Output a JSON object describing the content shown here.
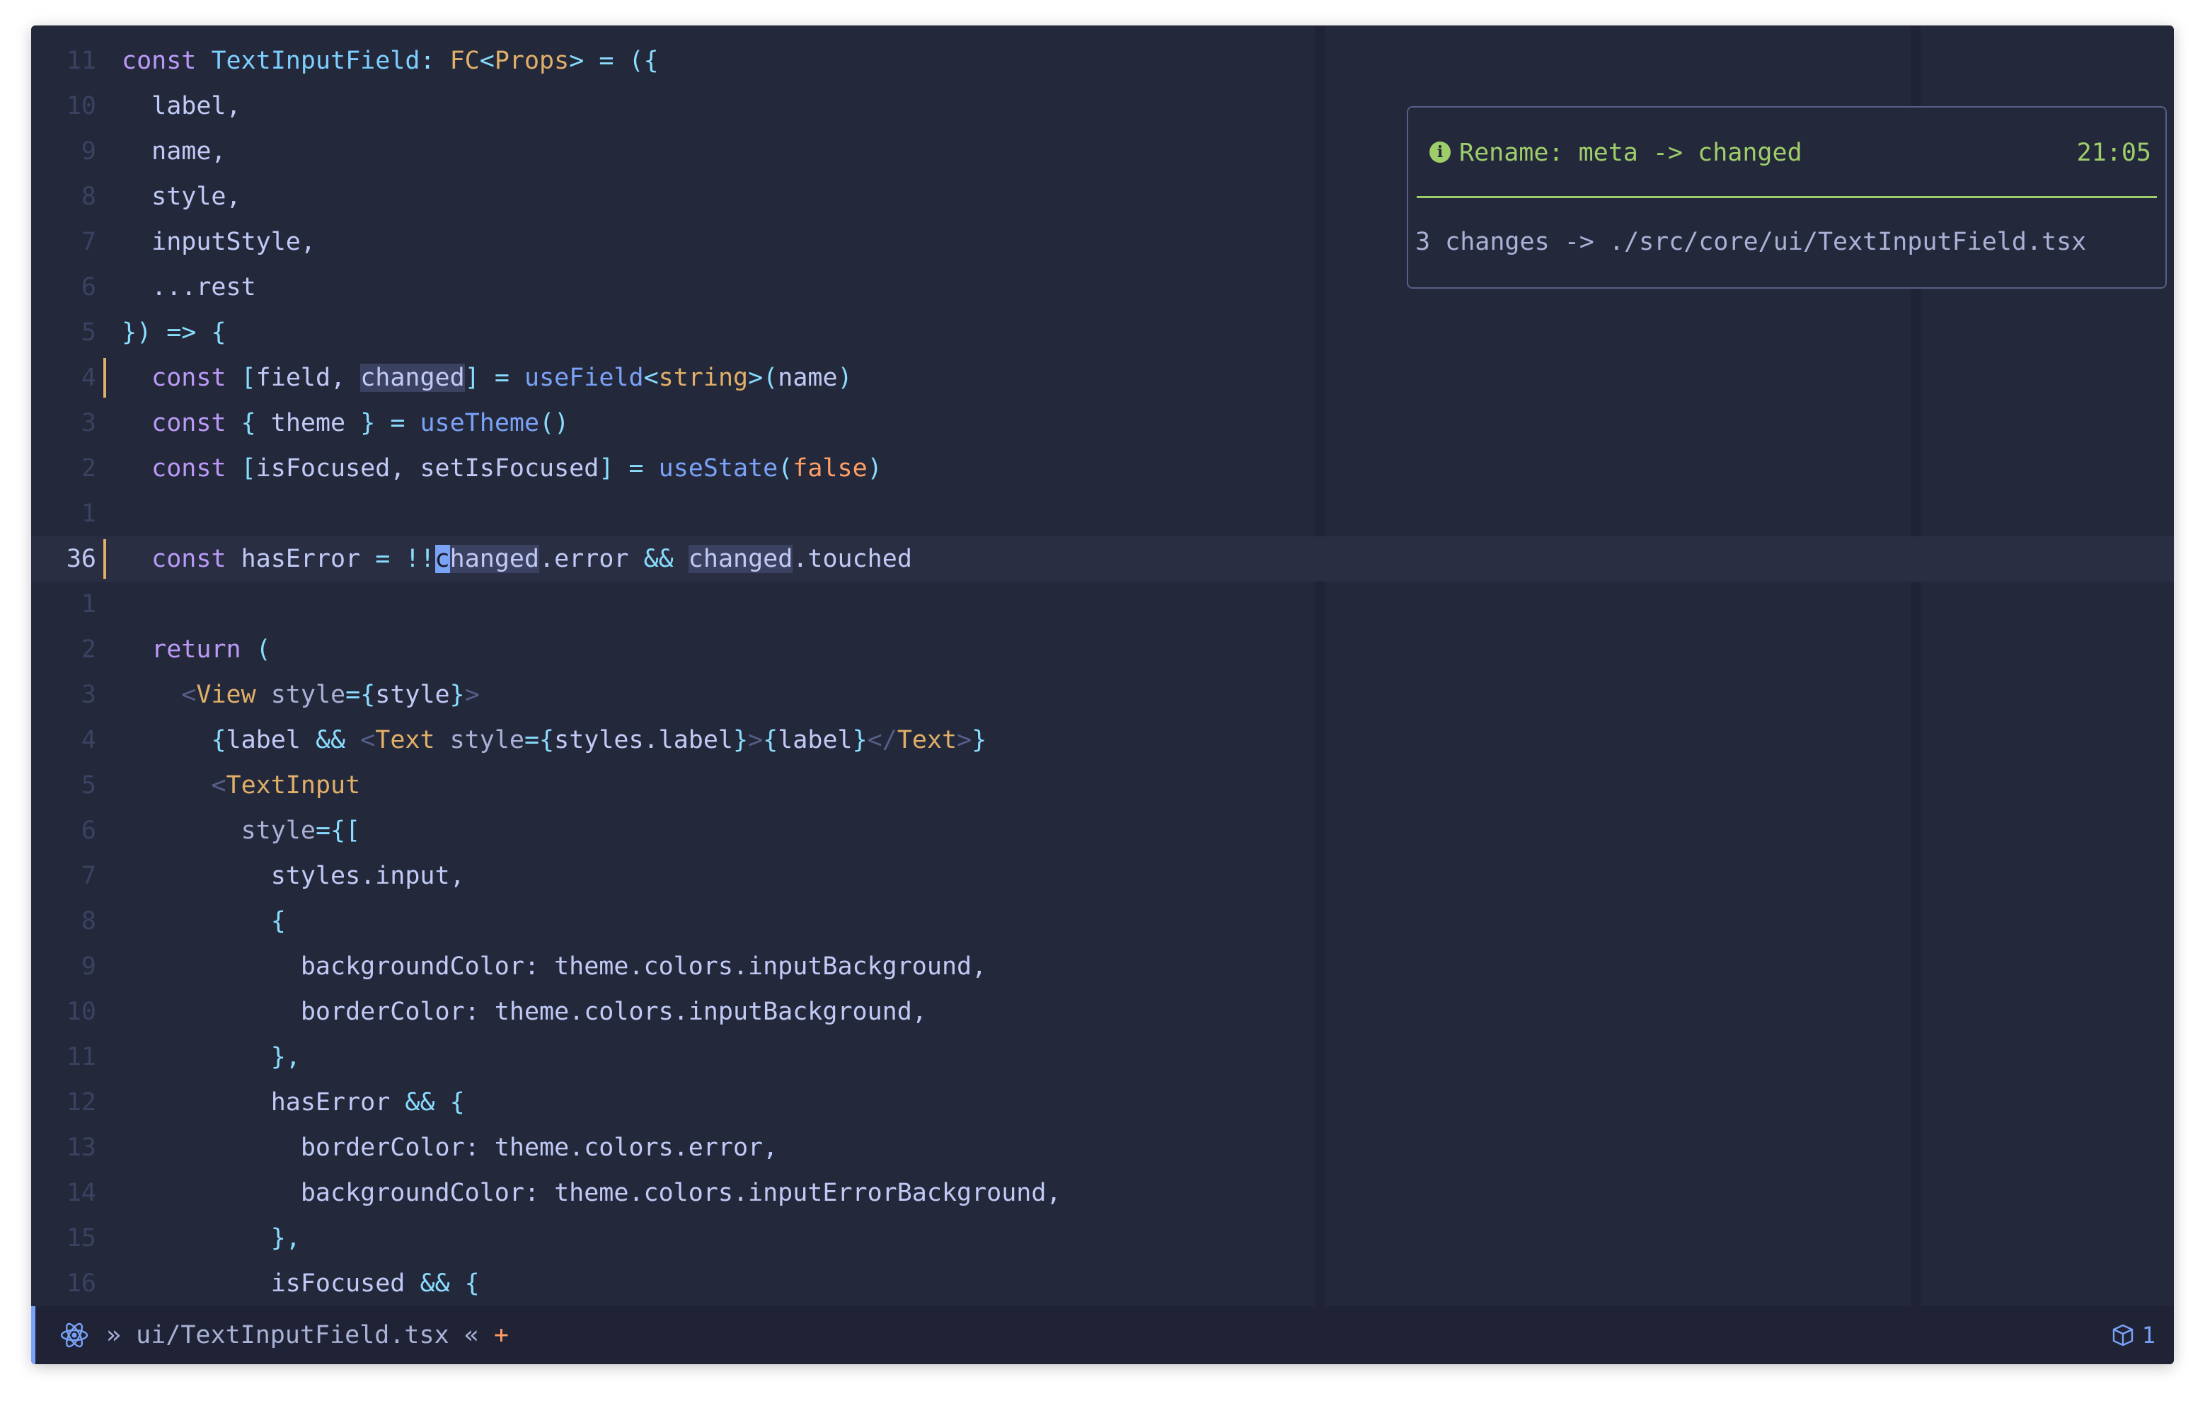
{
  "editor": {
    "lines": [
      {
        "num": "11",
        "current": false,
        "git": false,
        "tokens": [
          [
            "k",
            "const "
          ],
          [
            "t",
            "TextInputField"
          ],
          [
            "p",
            ": "
          ],
          [
            "y",
            "FC"
          ],
          [
            "p",
            "<"
          ],
          [
            "y",
            "Props"
          ],
          [
            "p",
            "> = ({"
          ]
        ]
      },
      {
        "num": "10",
        "current": false,
        "git": false,
        "tokens": [
          [
            "v",
            "  label,"
          ]
        ]
      },
      {
        "num": "9",
        "current": false,
        "git": false,
        "tokens": [
          [
            "v",
            "  name,"
          ]
        ]
      },
      {
        "num": "8",
        "current": false,
        "git": false,
        "tokens": [
          [
            "v",
            "  style,"
          ]
        ]
      },
      {
        "num": "7",
        "current": false,
        "git": false,
        "tokens": [
          [
            "v",
            "  inputStyle,"
          ]
        ]
      },
      {
        "num": "6",
        "current": false,
        "git": false,
        "tokens": [
          [
            "v",
            "  ...rest"
          ]
        ]
      },
      {
        "num": "5",
        "current": false,
        "git": false,
        "tokens": [
          [
            "p",
            "}) => {"
          ]
        ]
      },
      {
        "num": "4",
        "current": false,
        "git": true,
        "tokens": [
          [
            "v",
            "  "
          ],
          [
            "k",
            "const "
          ],
          [
            "p",
            "["
          ],
          [
            "v",
            "field, "
          ],
          [
            "hl",
            "changed"
          ],
          [
            "p",
            "] = "
          ],
          [
            "f",
            "useField"
          ],
          [
            "p",
            "<"
          ],
          [
            "y",
            "string"
          ],
          [
            "p",
            ">("
          ],
          [
            "v",
            "name"
          ],
          [
            "p",
            ")"
          ]
        ]
      },
      {
        "num": "3",
        "current": false,
        "git": false,
        "tokens": [
          [
            "v",
            "  "
          ],
          [
            "k",
            "const "
          ],
          [
            "p",
            "{ "
          ],
          [
            "v",
            "theme "
          ],
          [
            "p",
            "} = "
          ],
          [
            "f",
            "useTheme"
          ],
          [
            "p",
            "()"
          ]
        ]
      },
      {
        "num": "2",
        "current": false,
        "git": false,
        "tokens": [
          [
            "v",
            "  "
          ],
          [
            "k",
            "const "
          ],
          [
            "p",
            "["
          ],
          [
            "v",
            "isFocused, setIsFocused"
          ],
          [
            "p",
            "] = "
          ],
          [
            "f",
            "useState"
          ],
          [
            "p",
            "("
          ],
          [
            "o",
            "false"
          ],
          [
            "p",
            ")"
          ]
        ]
      },
      {
        "num": "1",
        "current": false,
        "git": false,
        "tokens": []
      },
      {
        "num": "36",
        "current": true,
        "git": true,
        "tokens": [
          [
            "v",
            "  "
          ],
          [
            "k",
            "const "
          ],
          [
            "v",
            "hasError "
          ],
          [
            "p",
            "= !!"
          ],
          [
            "cursor",
            "c"
          ],
          [
            "hl",
            "hanged"
          ],
          [
            "v",
            ".error "
          ],
          [
            "p",
            "&& "
          ],
          [
            "hl",
            "changed"
          ],
          [
            "v",
            ".touched"
          ]
        ]
      },
      {
        "num": "1",
        "current": false,
        "git": false,
        "tokens": []
      },
      {
        "num": "2",
        "current": false,
        "git": false,
        "tokens": [
          [
            "v",
            "  "
          ],
          [
            "k",
            "return "
          ],
          [
            "p",
            "("
          ]
        ]
      },
      {
        "num": "3",
        "current": false,
        "git": false,
        "tokens": [
          [
            "v",
            "    "
          ],
          [
            "tg",
            "<"
          ],
          [
            "y",
            "View "
          ],
          [
            "g",
            "style"
          ],
          [
            "p",
            "={"
          ],
          [
            "v",
            "style"
          ],
          [
            "p",
            "}"
          ],
          [
            "tg",
            ">"
          ]
        ]
      },
      {
        "num": "4",
        "current": false,
        "git": false,
        "tokens": [
          [
            "v",
            "      "
          ],
          [
            "p",
            "{"
          ],
          [
            "v",
            "label "
          ],
          [
            "p",
            "&& "
          ],
          [
            "tg",
            "<"
          ],
          [
            "y",
            "Text "
          ],
          [
            "g",
            "style"
          ],
          [
            "p",
            "={"
          ],
          [
            "v",
            "styles.label"
          ],
          [
            "p",
            "}"
          ],
          [
            "tg",
            ">"
          ],
          [
            "p",
            "{"
          ],
          [
            "v",
            "label"
          ],
          [
            "p",
            "}"
          ],
          [
            "tg",
            "</"
          ],
          [
            "y",
            "Text"
          ],
          [
            "tg",
            ">"
          ],
          [
            "p",
            "}"
          ]
        ]
      },
      {
        "num": "5",
        "current": false,
        "git": false,
        "tokens": [
          [
            "v",
            "      "
          ],
          [
            "tg",
            "<"
          ],
          [
            "y",
            "TextInput"
          ]
        ]
      },
      {
        "num": "6",
        "current": false,
        "git": false,
        "tokens": [
          [
            "v",
            "        "
          ],
          [
            "g",
            "style"
          ],
          [
            "p",
            "={["
          ]
        ]
      },
      {
        "num": "7",
        "current": false,
        "git": false,
        "tokens": [
          [
            "v",
            "          styles.input,"
          ]
        ]
      },
      {
        "num": "8",
        "current": false,
        "git": false,
        "tokens": [
          [
            "v",
            "          "
          ],
          [
            "p",
            "{"
          ]
        ]
      },
      {
        "num": "9",
        "current": false,
        "git": false,
        "tokens": [
          [
            "v",
            "            backgroundColor: theme.colors.inputBackground,"
          ]
        ]
      },
      {
        "num": "10",
        "current": false,
        "git": false,
        "tokens": [
          [
            "v",
            "            borderColor: theme.colors.inputBackground,"
          ]
        ]
      },
      {
        "num": "11",
        "current": false,
        "git": false,
        "tokens": [
          [
            "v",
            "          "
          ],
          [
            "p",
            "},"
          ]
        ]
      },
      {
        "num": "12",
        "current": false,
        "git": false,
        "tokens": [
          [
            "v",
            "          hasError "
          ],
          [
            "p",
            "&& {"
          ]
        ]
      },
      {
        "num": "13",
        "current": false,
        "git": false,
        "tokens": [
          [
            "v",
            "            borderColor: theme.colors.error,"
          ]
        ]
      },
      {
        "num": "14",
        "current": false,
        "git": false,
        "tokens": [
          [
            "v",
            "            backgroundColor: theme.colors.inputErrorBackground,"
          ]
        ]
      },
      {
        "num": "15",
        "current": false,
        "git": false,
        "tokens": [
          [
            "v",
            "          "
          ],
          [
            "p",
            "},"
          ]
        ]
      },
      {
        "num": "16",
        "current": false,
        "git": false,
        "tokens": [
          [
            "v",
            "          isFocused "
          ],
          [
            "p",
            "&& {"
          ]
        ]
      }
    ]
  },
  "notification": {
    "icon": "info-icon",
    "title": "Rename: meta -> changed",
    "time": "21:05",
    "body": "3 changes -> ./src/core/ui/TextInputField.tsx"
  },
  "statusbar": {
    "icon": "react-icon",
    "file": "» ui/TextInputField.tsx «",
    "modified": "+",
    "right_icon": "box-icon",
    "right_count": "1"
  },
  "colors": {
    "background": "#24283b",
    "keyword": "#bb9af7",
    "type": "#7dcfff",
    "function": "#7aa2f7",
    "string_type": "#e0af68",
    "boolean": "#ff9e64",
    "notification": "#9ece6a"
  }
}
